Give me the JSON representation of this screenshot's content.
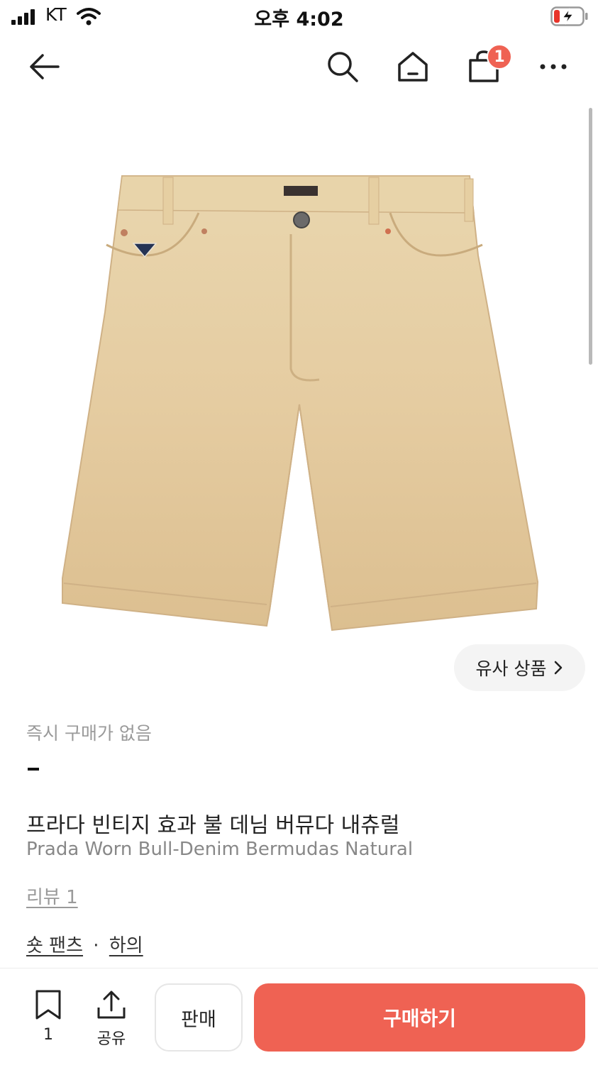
{
  "status_bar": {
    "carrier": "KT",
    "time": "오후 4:02"
  },
  "nav": {
    "cart_badge": "1"
  },
  "product": {
    "similar_label": "유사 상품",
    "instant_buy_label": "즉시 구매가 없음",
    "price": "-",
    "title_ko": "프라다 빈티지 효과 불 데님 버뮤다 내츄럴",
    "title_en": "Prada Worn Bull-Denim Bermudas Natural",
    "review_label": "리뷰 1",
    "category": {
      "primary": "숏 팬츠",
      "separator": "·",
      "secondary": "하의"
    }
  },
  "bottom_bar": {
    "bookmark_count": "1",
    "share_label": "공유",
    "sell_label": "판매",
    "buy_label": "구매하기"
  },
  "colors": {
    "accent": "#ef6253",
    "product_beige": "#e3c99d"
  },
  "icons": [
    "back-arrow-icon",
    "search-icon",
    "home-icon",
    "shopping-bag-icon",
    "more-icon",
    "bookmark-icon",
    "share-icon",
    "chevron-right-icon",
    "battery-charging-icon",
    "wifi-icon",
    "signal-icon"
  ]
}
